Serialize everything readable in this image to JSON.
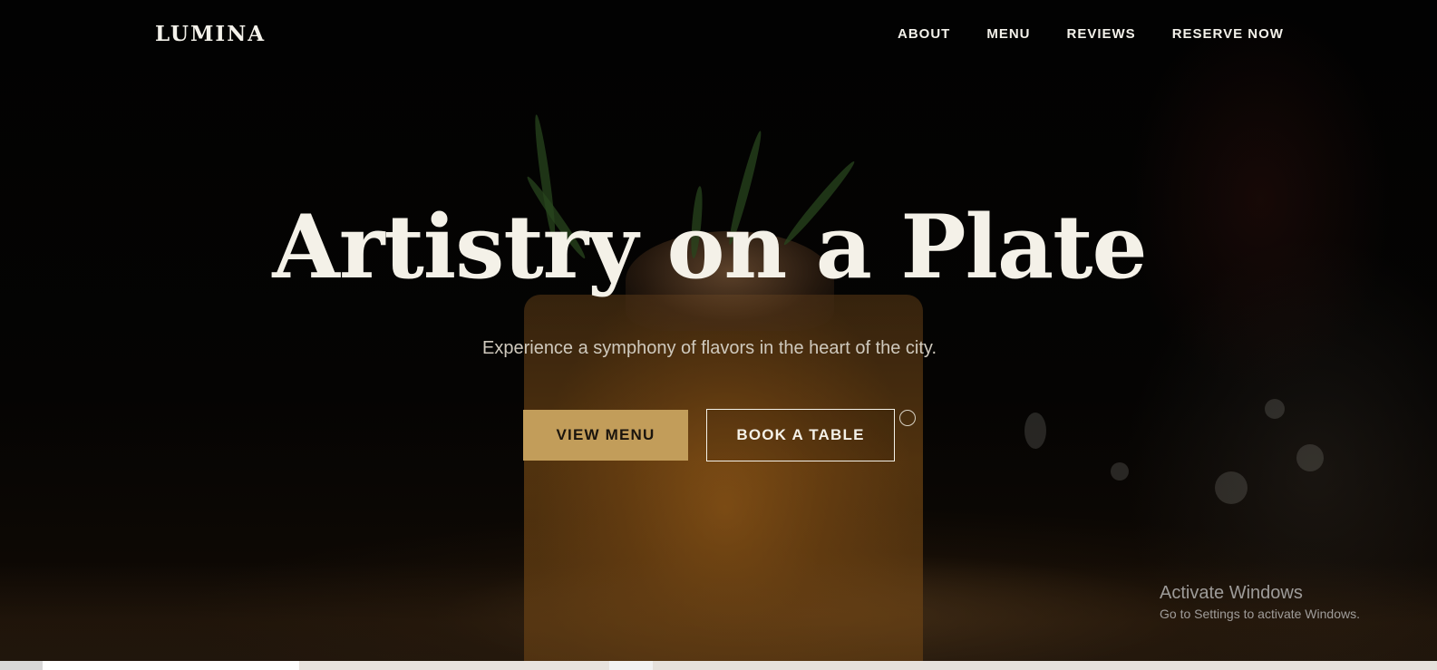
{
  "nav": {
    "logo": "LUMINA",
    "links": [
      "ABOUT",
      "MENU",
      "REVIEWS",
      "RESERVE NOW"
    ]
  },
  "hero": {
    "headline": "Artistry on a Plate",
    "subheadline": "Experience a symphony of flavors in the heart of the city.",
    "primary_button": "VIEW MENU",
    "secondary_button": "BOOK A TABLE"
  },
  "watermark": {
    "title": "Activate Windows",
    "subtitle": "Go to Settings to activate Windows."
  },
  "colors": {
    "accent": "#c29d5a",
    "text_light": "#f4f1e8",
    "background": "#000000"
  }
}
